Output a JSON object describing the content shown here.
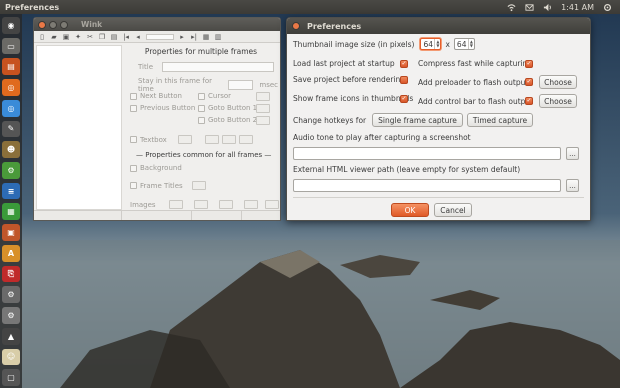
{
  "top_panel": {
    "title": "Preferences",
    "time": "1:41 AM"
  },
  "launcher": {
    "items": [
      {
        "name": "dash",
        "color": "#444",
        "glyph": "◉"
      },
      {
        "name": "files",
        "color": "#6b6a66",
        "glyph": "▭"
      },
      {
        "name": "home-folder",
        "color": "#c7521f",
        "glyph": "▤"
      },
      {
        "name": "firefox",
        "color": "#e06a1e",
        "glyph": "◎"
      },
      {
        "name": "chrome",
        "color": "#3a8bd8",
        "glyph": "◎"
      },
      {
        "name": "inkscape",
        "color": "#555",
        "glyph": "✎"
      },
      {
        "name": "gimp",
        "color": "#8a6f3a",
        "glyph": "☻"
      },
      {
        "name": "app-green",
        "color": "#4a9a3a",
        "glyph": "⚙"
      },
      {
        "name": "libreoffice-writer",
        "color": "#2d6bb5",
        "glyph": "≡"
      },
      {
        "name": "libreoffice-calc",
        "color": "#3a9a3a",
        "glyph": "▦"
      },
      {
        "name": "libreoffice-impress",
        "color": "#c0562a",
        "glyph": "▣"
      },
      {
        "name": "software-center",
        "color": "#d8902a",
        "glyph": "A"
      },
      {
        "name": "pdf-reader",
        "color": "#c02a2a",
        "glyph": "⎘"
      },
      {
        "name": "app-gear",
        "color": "#6a6a6a",
        "glyph": "⚙"
      },
      {
        "name": "settings",
        "color": "#777",
        "glyph": "⚙"
      },
      {
        "name": "app-dark",
        "color": "#444",
        "glyph": "▲"
      },
      {
        "name": "wink",
        "color": "#d8cda8",
        "glyph": "☺"
      },
      {
        "name": "trash",
        "color": "#555",
        "glyph": "▢"
      }
    ]
  },
  "wink": {
    "title": "Wink",
    "properties_header": "Properties for multiple frames",
    "title_label": "Title",
    "stay_label": "Stay in this frame for time",
    "msec_label": "msec",
    "next_button_label": "Next Button",
    "cursor_label": "Cursor",
    "previous_button_label": "Previous Button",
    "goto1_label": "Goto Button 1",
    "goto2_label": "Goto Button 2",
    "textbox_label": "Textbox",
    "common_header": "— Properties common for all frames —",
    "background_label": "Background",
    "frame_titles_label": "Frame Titles",
    "images_label": "Images"
  },
  "prefs": {
    "title": "Preferences",
    "thumb_label": "Thumbnail image size (in pixels)",
    "thumb_w": "64",
    "thumb_x": "x",
    "thumb_h": "64",
    "load_last_label": "Load last project at startup",
    "compress_label": "Compress fast while capturing",
    "save_before_label": "Save project before rendering",
    "preloader_label": "Add preloader to flash output",
    "choose1_label": "Choose",
    "show_icons_label": "Show frame icons in thumbnails",
    "control_bar_label": "Add control bar to flash output",
    "choose2_label": "Choose",
    "hotkeys_label": "Change hotkeys for",
    "single_frame_label": "Single frame capture",
    "timed_capture_label": "Timed capture",
    "audio_label": "Audio tone to play after capturing a screenshot",
    "audio_value": "",
    "browse1_label": "...",
    "html_viewer_label": "External HTML viewer path (leave empty for system default)",
    "html_viewer_value": "",
    "browse2_label": "...",
    "ok_label": "OK",
    "cancel_label": "Cancel",
    "checks": {
      "load_last": true,
      "compress": true,
      "save_before": false,
      "preloader": true,
      "show_icons": true,
      "control_bar": true
    }
  }
}
